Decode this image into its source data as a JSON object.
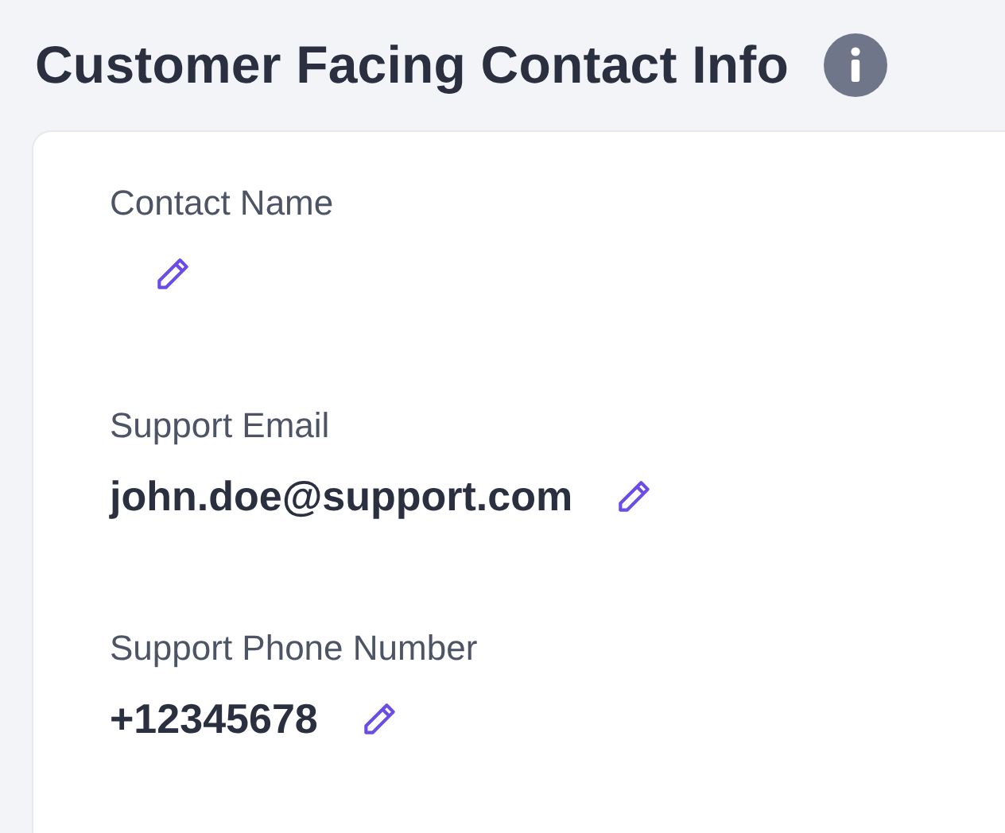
{
  "header": {
    "title": "Customer Facing Contact Info"
  },
  "fields": [
    {
      "label": "Contact Name"
    },
    {
      "label": "Support Email",
      "value": "john.doe@support.com"
    },
    {
      "label": "Support Phone Number",
      "value": "+12345678"
    }
  ]
}
